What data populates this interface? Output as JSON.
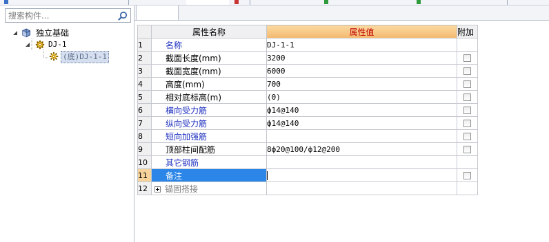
{
  "search": {
    "placeholder": "搜索构件..."
  },
  "tree": {
    "root": {
      "label": "独立基础"
    },
    "child": {
      "label": "DJ-1"
    },
    "grandchild": {
      "label": "(底)DJ-1-1"
    }
  },
  "grid": {
    "headers": {
      "name": "属性名称",
      "value": "属性值",
      "extra": "附加"
    },
    "rows": [
      {
        "num": "1",
        "name": "名称",
        "value": "DJ-1-1"
      },
      {
        "num": "2",
        "name": "截面长度(mm)",
        "value": "3200"
      },
      {
        "num": "3",
        "name": "截面宽度(mm)",
        "value": "6000"
      },
      {
        "num": "4",
        "name": "高度(mm)",
        "value": "700"
      },
      {
        "num": "5",
        "name": "相对底标高(m)",
        "value": "(0)"
      },
      {
        "num": "6",
        "name": "横向受力筋",
        "value": "ф14@140"
      },
      {
        "num": "7",
        "name": "纵向受力筋",
        "value": "ф14@140"
      },
      {
        "num": "8",
        "name": "短向加强筋",
        "value": ""
      },
      {
        "num": "9",
        "name": "顶部柱间配筋",
        "value": "8ф20@100/ф12@200"
      },
      {
        "num": "10",
        "name": "其它钢筋",
        "value": ""
      },
      {
        "num": "11",
        "name": "备注",
        "value": ""
      },
      {
        "num": "12",
        "name": "锚固搭接",
        "value": ""
      }
    ]
  },
  "colors": {
    "header_value_bg": "#f3b970",
    "header_value_text": "#c00000",
    "blue_text": "#1d2fc0",
    "selection": "#2b86e8"
  },
  "icons": {
    "search": "search-icon",
    "root": "foundation-icon",
    "component": "gear-icon",
    "expand": "expand-icon"
  }
}
